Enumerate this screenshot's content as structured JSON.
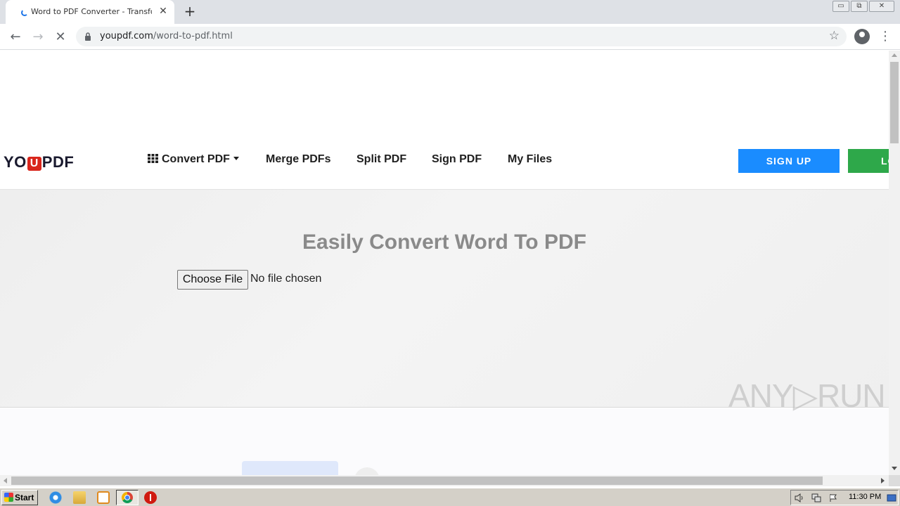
{
  "browser": {
    "tab_title": "Word to PDF Converter - Transform",
    "tab_close": "✕",
    "new_tab": "+",
    "url_host": "youpdf.com",
    "url_path": "/word-to-pdf.html",
    "window_controls": {
      "minimize": "▭",
      "restore": "⧉",
      "close": "✕"
    },
    "nav": {
      "back": "←",
      "forward": "→",
      "stop": "✕"
    },
    "bookmark_icon": "☆",
    "menu_icon": "⋮"
  },
  "site": {
    "logo_left": "YO",
    "logo_mark": "U",
    "logo_right": "PDF",
    "nav": {
      "convert": "Convert PDF",
      "merge": "Merge PDFs",
      "split": "Split PDF",
      "sign": "Sign PDF",
      "files": "My Files"
    },
    "signup_label": "SIGN UP",
    "login_label": "LOGIN",
    "signup_color": "#1a8cff",
    "login_color": "#2ea84a"
  },
  "hero": {
    "title": "Easily Convert Word To PDF",
    "choose_file_label": "Choose File",
    "file_status": "No file chosen"
  },
  "watermark": "ANY▷RUN",
  "taskbar": {
    "start_label": "Start",
    "clock": "11:30 PM"
  }
}
